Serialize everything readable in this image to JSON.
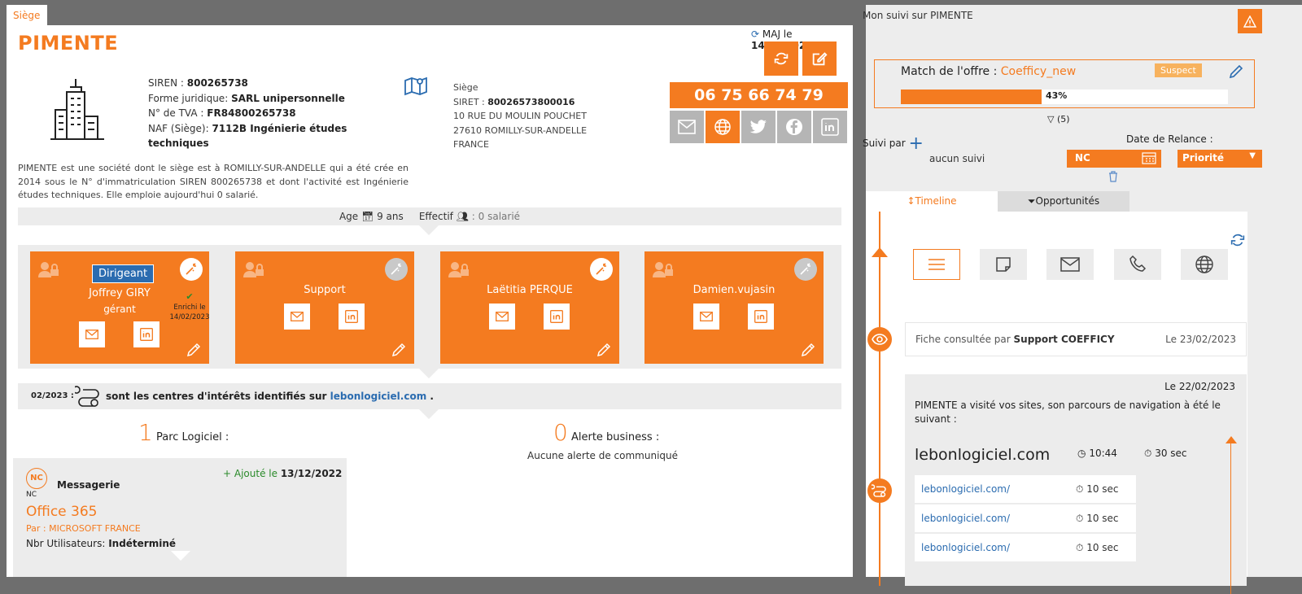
{
  "tab": {
    "label": "Siège"
  },
  "company": {
    "name": "PIMENTE",
    "maj_prefix": "MAJ le",
    "maj_date": "14/02/2023",
    "siren_label": "SIREN :",
    "siren": "800265738",
    "forme_label": "Forme juridique:",
    "forme": "SARL unipersonnelle",
    "tva_label": "N° de TVA :",
    "tva": "FR84800265738",
    "naf_label": "NAF (Siège):",
    "naf": "7112B Ingénierie études techniques",
    "siege_label": "Siège",
    "siret_label": "SIRET :",
    "siret": "80026573800016",
    "address1": "10 RUE DU MOULIN POUCHET",
    "address2": "27610 ROMILLY-SUR-ANDELLE",
    "country": "FRANCE",
    "phone": "06 75 66 74 79",
    "description": "PIMENTE est une société dont le siège est à ROMILLY-SUR-ANDELLE qui a été crée en 2014 sous le N° d'immatriculation SIREN 800265738 et dont l'activité est Ingénierie études techniques. Elle emploie aujourd'hui 0 salarié.",
    "age_label": "Age",
    "age": "9 ans",
    "effectif_label": "Effectif",
    "effectif": ": 0 salarié"
  },
  "contacts": [
    {
      "name": "Joffrey GIRY",
      "role": "Dirigeant",
      "title": "gérant",
      "enriched": "Enrichi le 14/02/2023"
    },
    {
      "name": "Support"
    },
    {
      "name": "Laëtitia PERQUE"
    },
    {
      "name": "Damien.vujasin"
    }
  ],
  "interests": {
    "date": "02/2023 :",
    "text": "sont les centres d'intérêts identifiés sur",
    "site": "lebonlogiciel.com",
    "suffix": "."
  },
  "parc": {
    "count": "1",
    "label": "Parc Logiciel :"
  },
  "alerts": {
    "count": "0",
    "label": "Alerte business :",
    "empty": "Aucune alerte de communiqué"
  },
  "software": {
    "badge": "NC",
    "badge_sub": "NC",
    "category": "Messagerie",
    "added_prefix": "+ Ajouté le",
    "added_date": "13/12/2022",
    "name": "Office 365",
    "vendor": "Par : MICROSOFT FRANCE",
    "users_label": "Nbr Utilisateurs:",
    "users": "Indéterminé"
  },
  "panel": {
    "title": "Mon suivi sur PIMENTE",
    "match_label": "Match de l'offre :",
    "offer": "Coefficy_new",
    "suspect": "Suspect",
    "progress_text": "43%",
    "progress": 0.43,
    "count": "(5)",
    "suivi_label": "Suivi par",
    "suivi_value": "aucun suivi",
    "relance_label": "Date de Relance :",
    "relance_value": "NC",
    "priority": "Priorité",
    "tab_timeline": "Timeline",
    "tab_opps": "Opportunités"
  },
  "timeline": {
    "event1_text": "Fiche consultée par",
    "event1_user": "Support COEFFICY",
    "event1_date": "Le 23/02/2023",
    "event2_date": "Le 22/02/2023",
    "event2_text": "PIMENTE a visité vos sites, son parcours de navigation à été le suivant :",
    "site": "lebonlogiciel.com",
    "time": "10:44",
    "duration": "30 sec",
    "visits": [
      {
        "url": "lebonlogiciel.com/",
        "time": "10 sec"
      },
      {
        "url": "lebonlogiciel.com/",
        "time": "10 sec"
      },
      {
        "url": "lebonlogiciel.com/",
        "time": "10 sec"
      }
    ]
  },
  "colors": {
    "accent": "#f47b20",
    "link": "#2b6cb0"
  }
}
